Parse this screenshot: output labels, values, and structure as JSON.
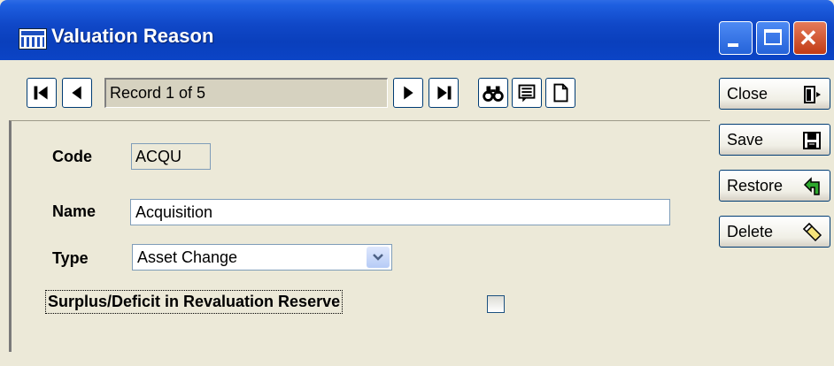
{
  "window": {
    "title": "Valuation Reason",
    "controls": {
      "minimize": "minimize-icon",
      "maximize": "maximize-icon",
      "close": "close-icon"
    }
  },
  "nav": {
    "record_text": "Record 1 of 5",
    "buttons": [
      "first-record-icon",
      "previous-record-icon",
      "next-record-icon",
      "last-record-icon",
      "find-binoculars-icon",
      "list-view-icon",
      "new-record-icon"
    ]
  },
  "form": {
    "code_label": "Code",
    "code_value": "ACQU",
    "name_label": "Name",
    "name_value": "Acquisition",
    "type_label": "Type",
    "type_value": "Asset Change",
    "surplus_label": "Surplus/Deficit in Revaluation Reserve",
    "surplus_checked": false
  },
  "actions": {
    "close": "Close",
    "save": "Save",
    "restore": "Restore",
    "delete": "Delete"
  },
  "colors": {
    "titlebar": "#0a3fbc",
    "window_bg": "#ece9d8",
    "button_border": "#003c74",
    "close_button": "#c23b14"
  }
}
